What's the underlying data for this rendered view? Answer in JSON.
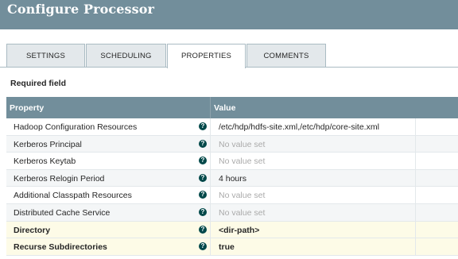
{
  "dialog": {
    "title": "Configure Processor"
  },
  "tabs": [
    {
      "label": "SETTINGS",
      "active": false
    },
    {
      "label": "SCHEDULING",
      "active": false
    },
    {
      "label": "PROPERTIES",
      "active": true
    },
    {
      "label": "COMMENTS",
      "active": false
    }
  ],
  "required_note": "Required field",
  "table": {
    "headers": {
      "property": "Property",
      "value": "Value"
    },
    "rows": [
      {
        "name": "Hadoop Configuration Resources",
        "value": "/etc/hdp/hdfs-site.xml,/etc/hdp/core-site.xml",
        "set": true,
        "required": false,
        "help_icon": "?"
      },
      {
        "name": "Kerberos Principal",
        "value": "No value set",
        "set": false,
        "required": false,
        "help_icon": "?"
      },
      {
        "name": "Kerberos Keytab",
        "value": "No value set",
        "set": false,
        "required": false,
        "help_icon": "?"
      },
      {
        "name": "Kerberos Relogin Period",
        "value": "4 hours",
        "set": true,
        "required": false,
        "help_icon": "?"
      },
      {
        "name": "Additional Classpath Resources",
        "value": "No value set",
        "set": false,
        "required": false,
        "help_icon": "?"
      },
      {
        "name": "Distributed Cache Service",
        "value": "No value set",
        "set": false,
        "required": false,
        "help_icon": "?"
      },
      {
        "name": "Directory",
        "value": "<dir-path>",
        "set": true,
        "required": true,
        "help_icon": "?"
      },
      {
        "name": "Recurse Subdirectories",
        "value": "true",
        "set": true,
        "required": true,
        "help_icon": "?"
      }
    ]
  },
  "colors": {
    "header_bg": "#728e9b",
    "required_row_bg": "#fdfbe7",
    "help_icon_bg": "#004849",
    "empty_value_text": "#aaaaaa"
  }
}
